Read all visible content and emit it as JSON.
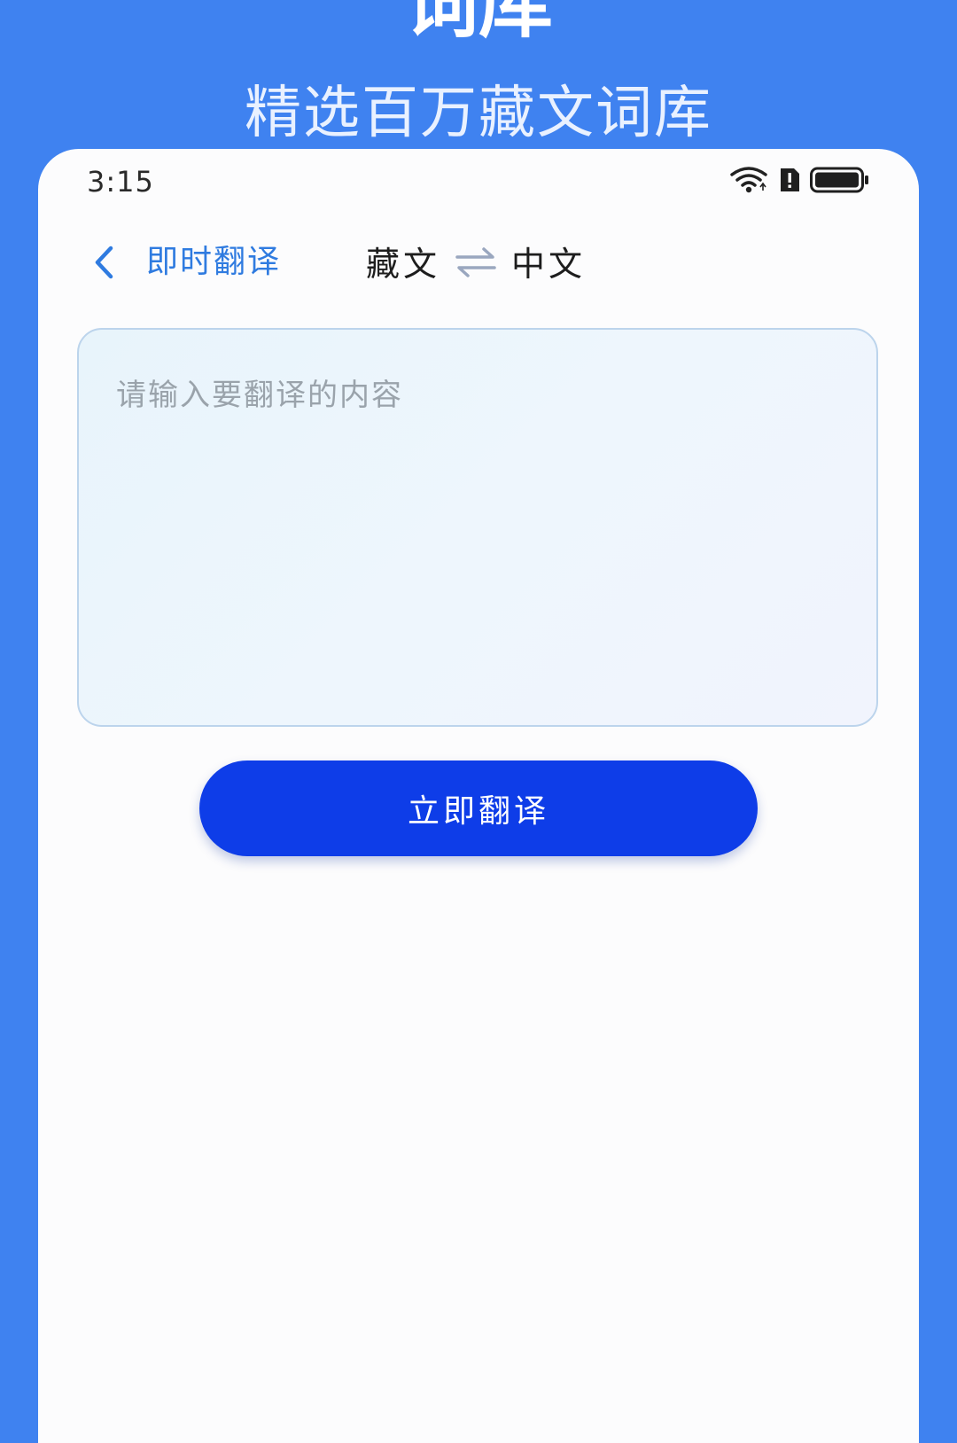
{
  "promo": {
    "title": "词库",
    "subtitle": "精选百万藏文词库"
  },
  "status_bar": {
    "time": "3:15",
    "icons": [
      "wifi-icon",
      "alert-icon",
      "battery-icon"
    ]
  },
  "header": {
    "back_icon": "chevron-left-icon",
    "title": "即时翻译",
    "source_lang": "藏文",
    "swap_icon": "swap-arrows-icon",
    "target_lang": "中文"
  },
  "input": {
    "placeholder": "请输入要翻译的内容",
    "value": ""
  },
  "actions": {
    "translate_label": "立即翻译"
  },
  "colors": {
    "background": "#3f82f0",
    "accent_text": "#2f7be0",
    "primary_button": "#0e3de8"
  }
}
